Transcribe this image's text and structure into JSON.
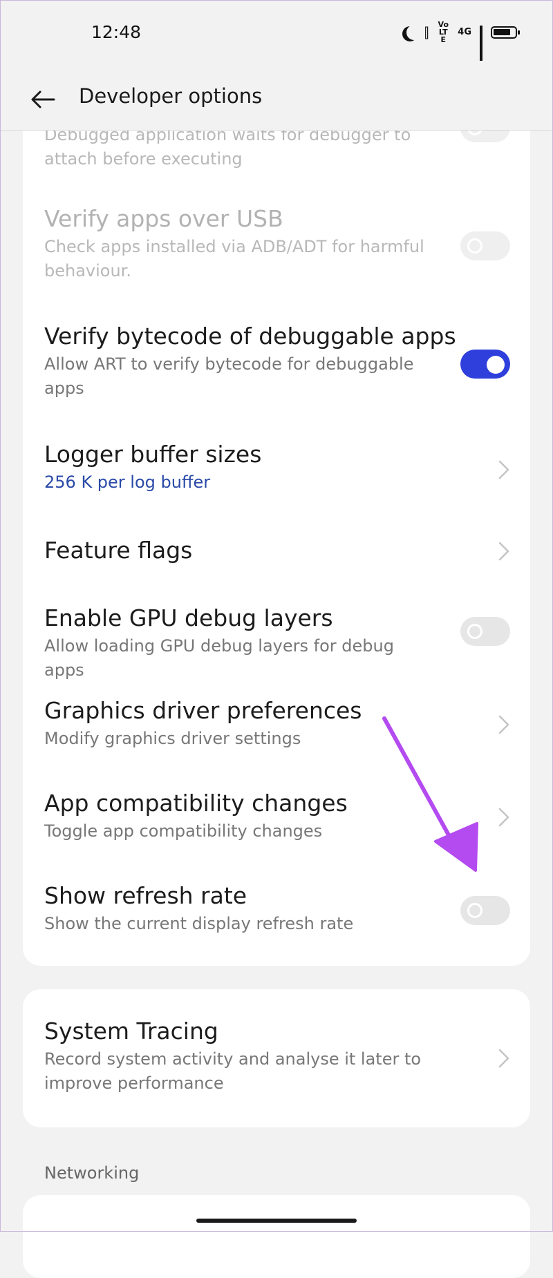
{
  "status_bar": {
    "time": "12:48",
    "network_badge": "4G",
    "volte_label": "Vo LTE"
  },
  "header": {
    "title": "Developer options"
  },
  "settings": [
    {
      "title": "",
      "subtitle": "Debugged application waits for debugger to attach before executing",
      "control": "toggle",
      "state": "off",
      "enabled": false
    },
    {
      "title": "Verify apps over USB",
      "subtitle": "Check apps installed via ADB/ADT for harmful behaviour.",
      "control": "toggle",
      "state": "off",
      "enabled": false
    },
    {
      "title": "Verify bytecode of debuggable apps",
      "subtitle": "Allow ART to verify bytecode for debuggable apps",
      "control": "toggle",
      "state": "on",
      "enabled": true
    },
    {
      "title": "Logger buffer sizes",
      "subtitle": "256 K per log buffer",
      "control": "chevron",
      "enabled": true
    },
    {
      "title": "Feature flags",
      "subtitle": "",
      "control": "chevron",
      "enabled": true
    },
    {
      "title": "Enable GPU debug layers",
      "subtitle": "Allow loading GPU debug layers for debug apps",
      "control": "toggle",
      "state": "off",
      "enabled": true
    },
    {
      "title": "Graphics driver preferences",
      "subtitle": "Modify graphics driver settings",
      "control": "chevron",
      "enabled": true
    },
    {
      "title": "App compatibility changes",
      "subtitle": "Toggle app compatibility changes",
      "control": "chevron",
      "enabled": true
    },
    {
      "title": "Show refresh rate",
      "subtitle": "Show the current display refresh rate",
      "control": "toggle",
      "state": "off",
      "enabled": true
    }
  ],
  "system_tracing": {
    "title": "System Tracing",
    "subtitle": "Record system activity and analyse it later to improve performance",
    "control": "chevron"
  },
  "sections": {
    "networking": "Networking"
  },
  "colors": {
    "accent": "#2e3fdc",
    "link": "#2a4aa8",
    "annotation_arrow": "#b44bf0",
    "background": "#f2f2f2",
    "card": "#ffffff"
  },
  "icons": {
    "back": "arrow-left-icon",
    "chevron": "chevron-right-icon",
    "moon": "moon-icon",
    "vibrate": "vibrate-icon",
    "signal": "signal-bars-icon",
    "battery": "battery-icon"
  }
}
